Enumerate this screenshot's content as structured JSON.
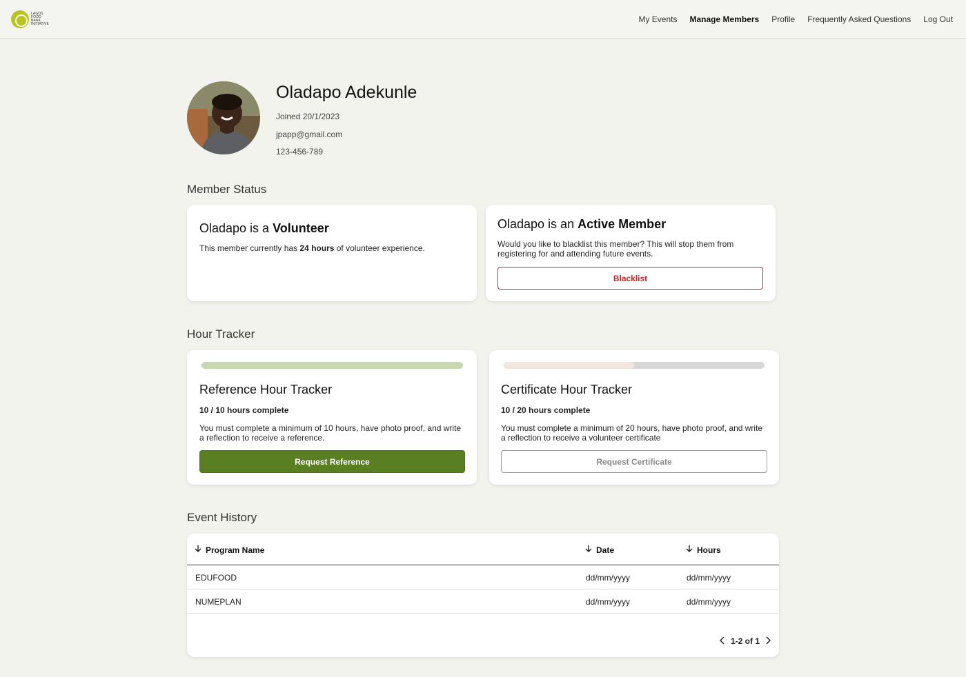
{
  "header": {
    "logo_text": [
      "LAGOS",
      "FOOD",
      "BANK",
      "INITIATIVE"
    ],
    "nav": [
      "My Events",
      "Manage Members",
      "Profile",
      "Frequently Asked Questions",
      "Log Out"
    ],
    "active_nav": "Manage Members"
  },
  "profile": {
    "name": "Oladapo Adekunle",
    "joined": "Joined 20/1/2023",
    "email": "jpapp@gmail.com",
    "phone": "123-456-789"
  },
  "member_status": {
    "title": "Member Status",
    "volunteer_card": {
      "title_prefix": "Oladapo is a ",
      "title_strong": "Volunteer",
      "text_prefix": "This member currently has ",
      "text_strong": "24 hours",
      "text_suffix": " of volunteer experience."
    },
    "active_card": {
      "title_prefix": "Oladapo is an ",
      "title_strong": "Active Member",
      "text": "Would you like to blacklist this member? This will stop them from registering for and attending future events.",
      "button": "Blacklist"
    }
  },
  "hour_tracker": {
    "title": "Hour Tracker",
    "reference": {
      "title": "Reference Hour Tracker",
      "hours": "10 / 10 hours complete",
      "progress": 1.0,
      "fill_color": "#c9d8b0",
      "text": "You must complete a minimum of 10 hours, have photo proof, and write a reflection to receive a reference.",
      "button": "Request Reference"
    },
    "certificate": {
      "title": "Certificate Hour Tracker",
      "hours": "10 / 20 hours complete",
      "progress": 0.5,
      "fill_color": "#f3e6dd",
      "text": "You must complete a minimum of 20 hours, have photo proof, and write a reflection to receive a volunteer certificate",
      "button": "Request Certificate"
    }
  },
  "event_history": {
    "title": "Event History",
    "columns": [
      "Program Name",
      "Date",
      "Hours"
    ],
    "rows": [
      [
        "EDUFOOD",
        "dd/mm/yyyy",
        "dd/mm/yyyy"
      ],
      [
        "NUMEPLAN",
        "dd/mm/yyyy",
        "dd/mm/yyyy"
      ]
    ],
    "pagination": "1-2 of 1"
  },
  "colors": {
    "accent_green": "#5a7e22",
    "danger_red": "#c62828",
    "background": "#f1f3ec"
  }
}
